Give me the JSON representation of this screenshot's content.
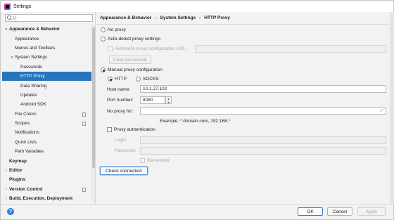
{
  "window": {
    "title": "Settings"
  },
  "search": {
    "placeholder": "Q-",
    "value": ""
  },
  "sidebar": {
    "items": [
      {
        "label": "Appearance & Behavior",
        "arrow": "▾",
        "bold": true,
        "indent": 0
      },
      {
        "label": "Appearance",
        "arrow": "",
        "bold": false,
        "indent": 1
      },
      {
        "label": "Menus and Toolbars",
        "arrow": "",
        "bold": false,
        "indent": 1
      },
      {
        "label": "System Settings",
        "arrow": "▾",
        "bold": false,
        "indent": 1
      },
      {
        "label": "Passwords",
        "arrow": "",
        "bold": false,
        "indent": 2
      },
      {
        "label": "HTTP Proxy",
        "arrow": "",
        "bold": false,
        "indent": 2,
        "selected": true
      },
      {
        "label": "Data Sharing",
        "arrow": "",
        "bold": false,
        "indent": 2
      },
      {
        "label": "Updates",
        "arrow": "",
        "bold": false,
        "indent": 2
      },
      {
        "label": "Android SDK",
        "arrow": "",
        "bold": false,
        "indent": 2
      },
      {
        "label": "File Colors",
        "arrow": "",
        "bold": false,
        "indent": 1,
        "proj": true
      },
      {
        "label": "Scopes",
        "arrow": "",
        "bold": false,
        "indent": 1,
        "proj": true
      },
      {
        "label": "Notifications",
        "arrow": "",
        "bold": false,
        "indent": 1
      },
      {
        "label": "Quick Lists",
        "arrow": "",
        "bold": false,
        "indent": 1
      },
      {
        "label": "Path Variables",
        "arrow": "",
        "bold": false,
        "indent": 1
      },
      {
        "label": "Keymap",
        "arrow": "",
        "bold": true,
        "indent": 0
      },
      {
        "label": "Editor",
        "arrow": "›",
        "bold": true,
        "indent": 0
      },
      {
        "label": "Plugins",
        "arrow": "",
        "bold": true,
        "indent": 0
      },
      {
        "label": "Version Control",
        "arrow": "›",
        "bold": true,
        "indent": 0,
        "proj": true
      },
      {
        "label": "Build, Execution, Deployment",
        "arrow": "›",
        "bold": true,
        "indent": 0
      }
    ]
  },
  "breadcrumb": {
    "part1": "Appearance & Behavior",
    "sep": "›",
    "part2": "System Settings",
    "part3": "HTTP Proxy"
  },
  "proxy": {
    "no_proxy": "No proxy",
    "auto_detect": "Auto-detect proxy settings",
    "auto_config_url": "Automatic proxy configuration URL:",
    "clear_passwords": "Clear passwords",
    "manual": "Manual proxy configuration",
    "http": "HTTP",
    "socks": "SOCKS",
    "host_label": "Host name:",
    "host_value": "10.1.27.102",
    "port_label": "Port number:",
    "port_value": "8080",
    "no_proxy_for_label": "No proxy for:",
    "no_proxy_for_value": "",
    "example": "Example: *.domain.com, 192.168.*",
    "proxy_auth": "Proxy authentication",
    "login_label": "Login:",
    "password_label": "Password:",
    "remember": "Remember",
    "check_connection": "Check connection"
  },
  "buttons": {
    "ok": "OK",
    "cancel": "Cancel",
    "apply": "Apply",
    "help": "?"
  }
}
